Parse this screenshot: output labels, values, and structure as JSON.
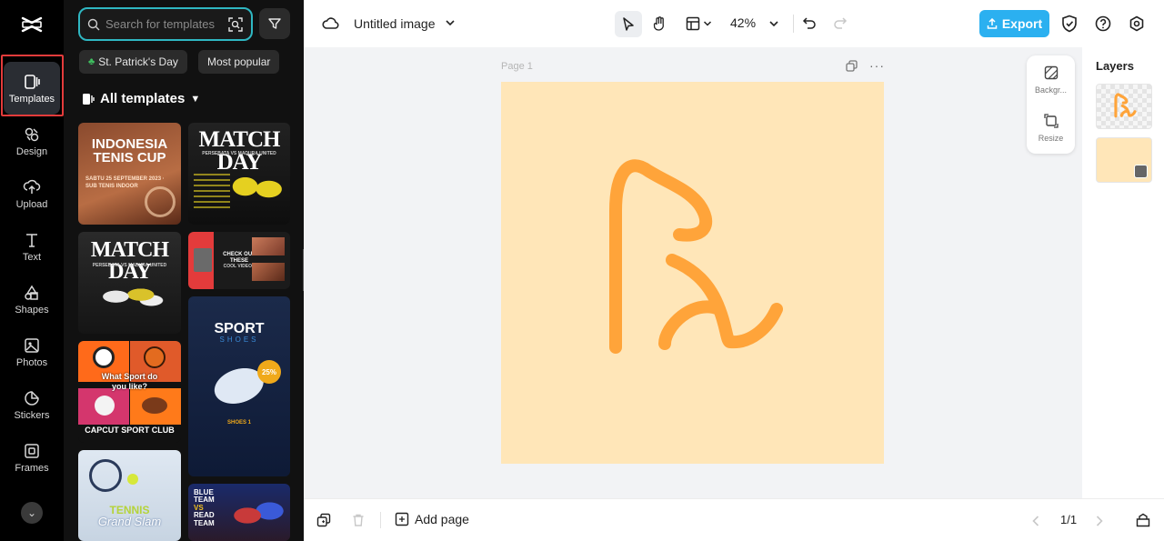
{
  "sidebar": {
    "items": [
      {
        "label": "Templates",
        "icon": "templates-icon"
      },
      {
        "label": "Design",
        "icon": "design-icon"
      },
      {
        "label": "Upload",
        "icon": "upload-icon"
      },
      {
        "label": "Text",
        "icon": "text-icon"
      },
      {
        "label": "Shapes",
        "icon": "shapes-icon"
      },
      {
        "label": "Photos",
        "icon": "photos-icon"
      },
      {
        "label": "Stickers",
        "icon": "stickers-icon"
      },
      {
        "label": "Frames",
        "icon": "frames-icon"
      }
    ],
    "active": "Templates"
  },
  "panel": {
    "search_placeholder": "Search for templates",
    "chips": [
      "St. Patrick's Day",
      "Most popular"
    ],
    "section_title": "All templates",
    "templates": [
      {
        "line1": "INDONESIA",
        "line2": "TENIS CUP",
        "sub": "SABTU 25 SEPTEMBER 2023 · SUB TENIS INDOOR"
      },
      {
        "line1": "MATCH DAY",
        "sub": "PERSEBATA VS MADURA UNITED"
      },
      {
        "line1": "MATCH DAY",
        "sub": "PERSEBATA VS MADURA UNITED"
      },
      {
        "line1": "CHECK OUT",
        "line2": "THESE",
        "sub": "COOL VIDEOS"
      },
      {
        "line1": "SPORT",
        "line2": "SHOES",
        "badge": "25%",
        "footer": "SHOES 1"
      },
      {
        "line1": "What Sport do",
        "line2": "you like?",
        "footer": "CAPCUT SPORT CLUB"
      },
      {
        "line1": "TENNIS",
        "line2": "Grand Slam"
      },
      {
        "line1": "BLUE",
        "line2": "TEAM",
        "line3": "VS",
        "line4": "READ",
        "line5": "TEAM"
      }
    ]
  },
  "topbar": {
    "document_title": "Untitled image",
    "zoom": "42%",
    "export_label": "Export"
  },
  "canvas": {
    "page_label": "Page 1",
    "page_color": "#ffe6b8",
    "stroke_color": "#ffa43a",
    "float_tools": [
      "Backgr...",
      "Resize"
    ]
  },
  "layers": {
    "title": "Layers"
  },
  "bottombar": {
    "add_page_label": "Add page",
    "page_count": "1/1"
  },
  "colors": {
    "accent": "#2bb0f0",
    "highlight": "#e43b3b",
    "search_border": "#2fb7c2"
  }
}
